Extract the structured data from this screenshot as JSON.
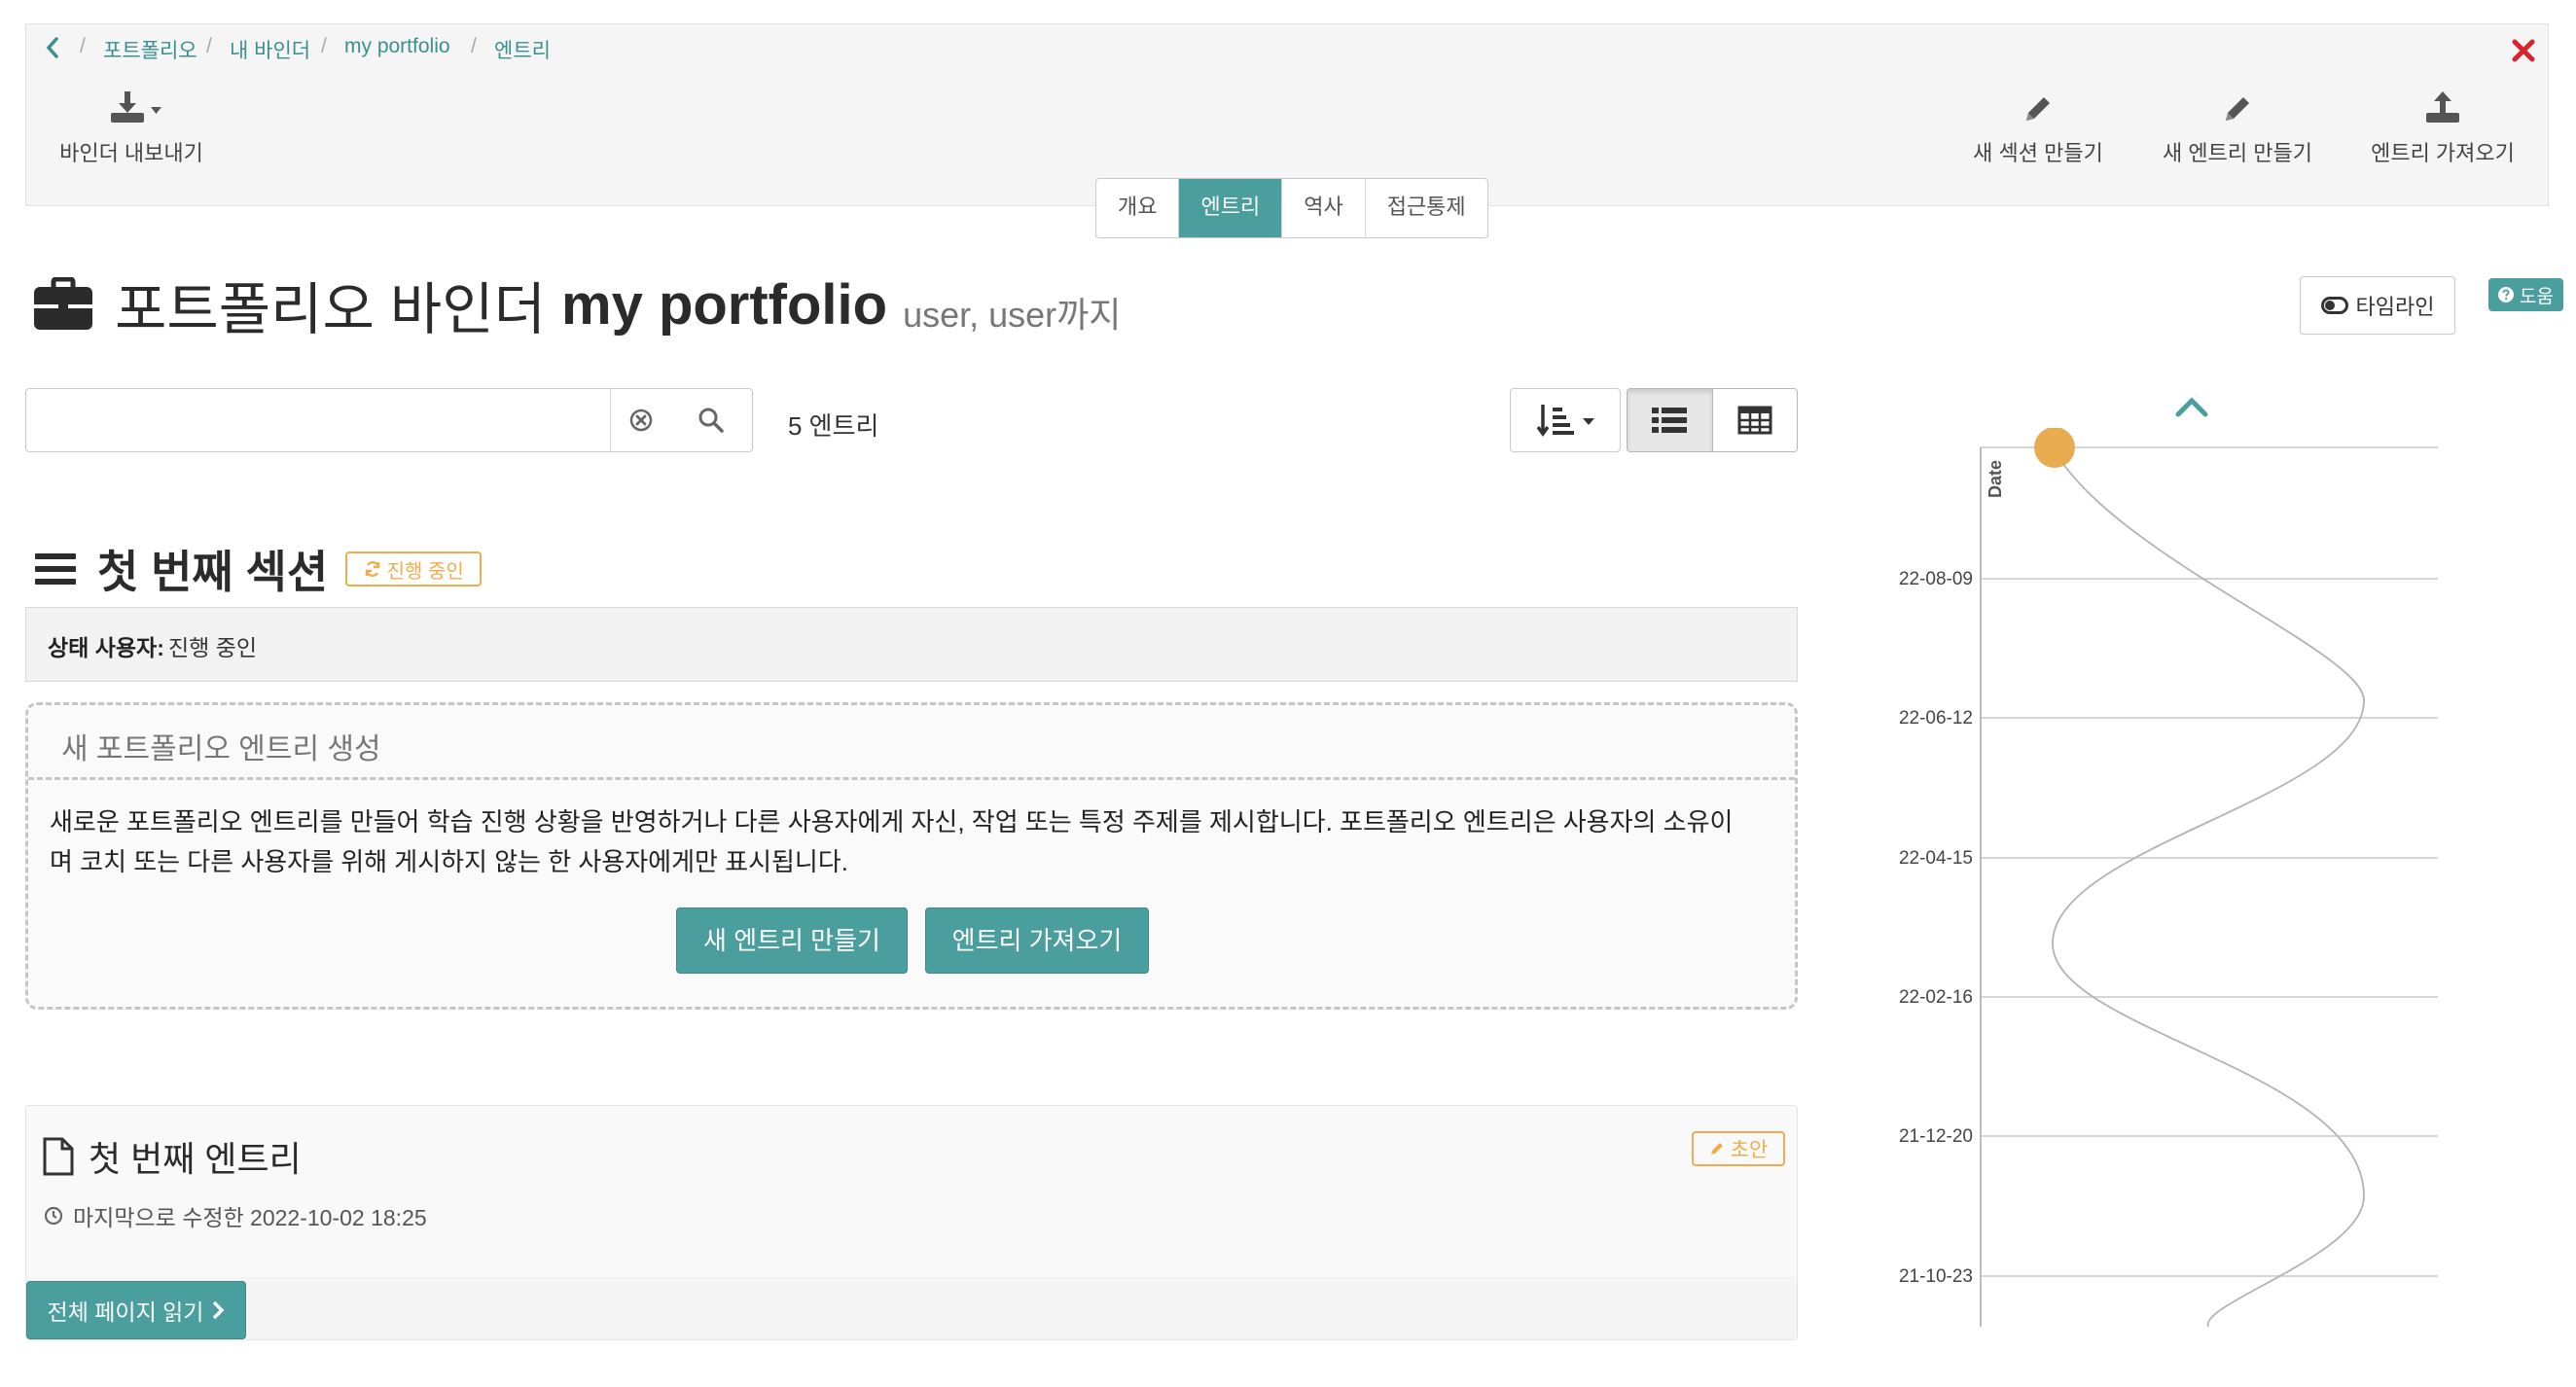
{
  "breadcrumb": {
    "items": [
      "포트폴리오",
      "내 바인더",
      "my portfolio",
      "엔트리"
    ],
    "separator": "/"
  },
  "toolbar": {
    "export_label": "바인더 내보내기",
    "new_section_label": "새 섹션 만들기",
    "new_entry_label": "새 엔트리 만들기",
    "import_entry_label": "엔트리 가져오기"
  },
  "tabs": [
    {
      "label": "개요",
      "active": false
    },
    {
      "label": "엔트리",
      "active": true
    },
    {
      "label": "역사",
      "active": false
    },
    {
      "label": "접근통제",
      "active": false
    }
  ],
  "page": {
    "title_prefix": "포트폴리오 바인더",
    "title_name": "my portfolio",
    "title_owner": "user, user까지",
    "timeline_button": "타임라인",
    "help_button": "도움"
  },
  "search": {
    "placeholder": "",
    "value": "",
    "entry_count": "5 엔트리"
  },
  "section": {
    "title": "첫 번째 섹션",
    "status_badge": "진행 중인",
    "status_label": "상태 사용자:",
    "status_value": "진행 중인"
  },
  "new_entry_box": {
    "heading": "새 포트폴리오 엔트리 생성",
    "description_line1": "새로운 포트폴리오 엔트리를 만들어 학습 진행 상황을 반영하거나 다른 사용자에게 자신, 작업 또는 특정 주제를 제시합니다. 포트폴리오 엔트리은 사용자의 소유이",
    "description_line2": "며 코치 또는 다른 사용자를 위해 게시하지 않는 한 사용자에게만 표시됩니다.",
    "create_button": "새 엔트리 만들기",
    "import_button": "엔트리 가져오기"
  },
  "entry": {
    "title": "첫 번째 엔트리",
    "draft_badge": "초안",
    "modified": "마지막으로 수정한 2022-10-02 18:25",
    "read_button": "전체 페이지 읽기"
  },
  "timeline": {
    "axis_label": "Date",
    "ticks": [
      "22-08-09",
      "22-06-12",
      "22-04-15",
      "22-02-16",
      "21-12-20",
      "21-10-23"
    ]
  },
  "colors": {
    "accent": "#4a9e9d",
    "link": "#3a8f8f",
    "warning": "#f0ad4e",
    "close": "#d9232d"
  },
  "icons": {
    "back": "chevron-left-icon",
    "close": "close-icon",
    "export": "download-icon",
    "new_section": "pencil-icon",
    "new_entry": "pencil-icon",
    "import": "upload-icon",
    "title": "briefcase-icon",
    "section": "bars-icon",
    "entry": "file-icon",
    "clock": "clock-icon"
  }
}
